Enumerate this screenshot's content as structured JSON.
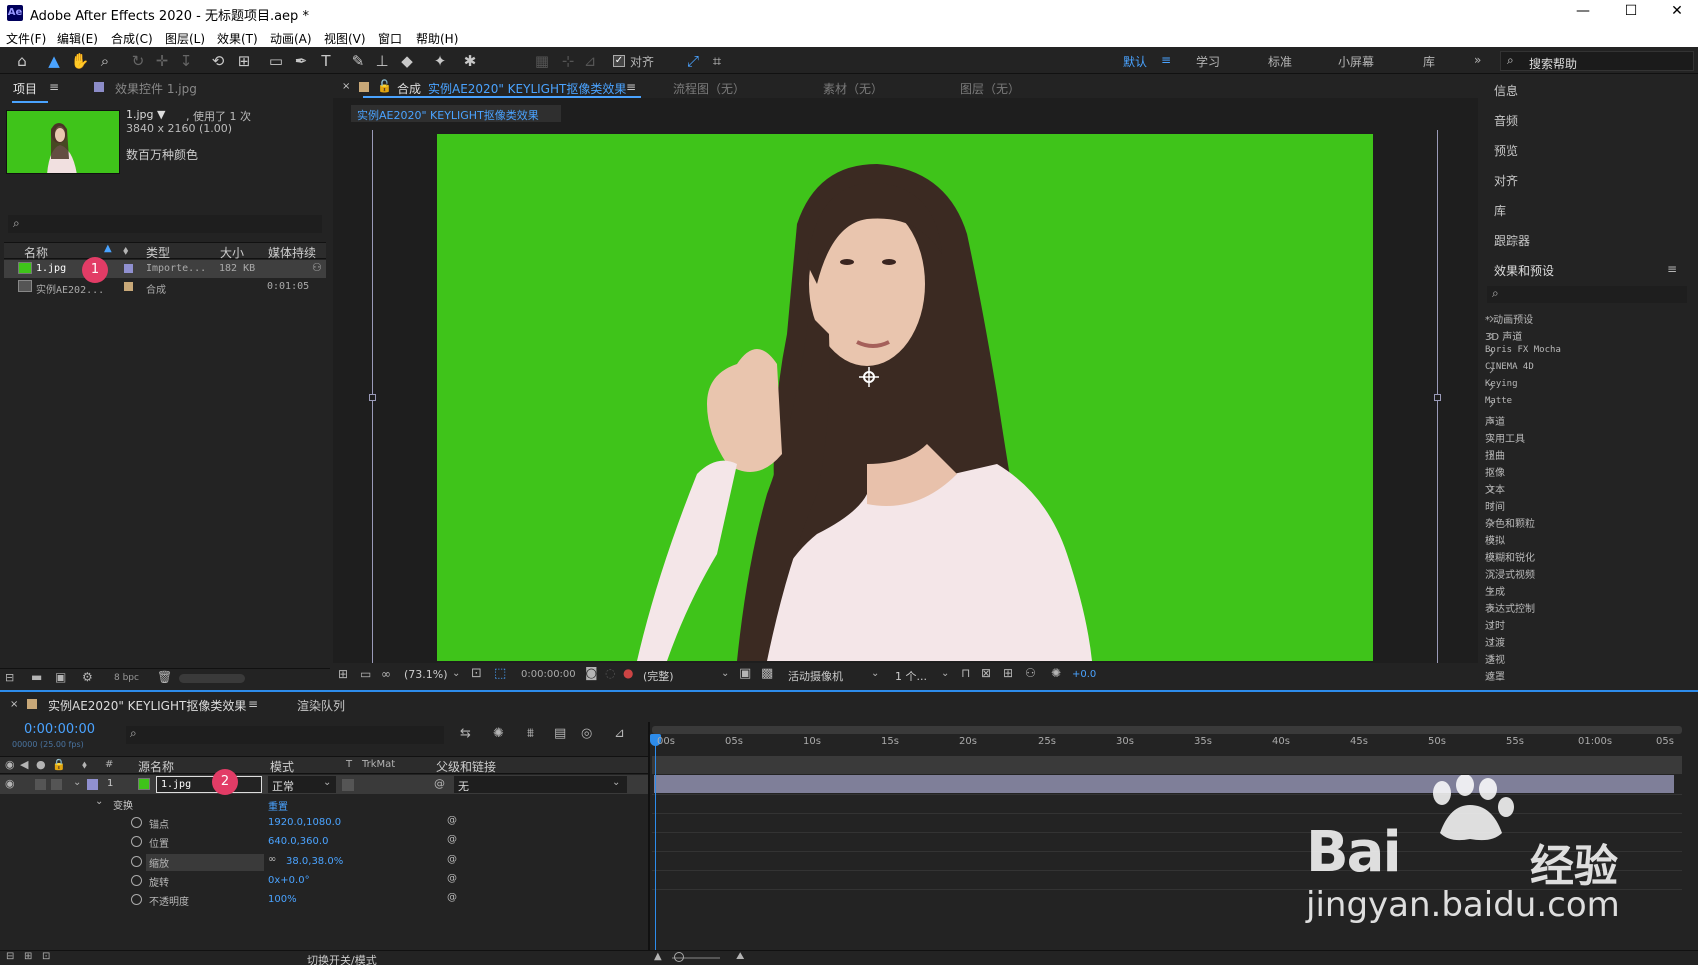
{
  "title_bar": {
    "app_title": "Adobe After Effects 2020 - 无标题项目.aep *",
    "ae_logo": "Ae",
    "minimize": "—",
    "maximize": "☐",
    "close": "✕"
  },
  "menu": [
    "文件(F)",
    "编辑(E)",
    "合成(C)",
    "图层(L)",
    "效果(T)",
    "动画(A)",
    "视图(V)",
    "窗口",
    "帮助(H)"
  ],
  "toolbar": {
    "snap_label": "对齐",
    "workspaces": [
      "默认",
      "学习",
      "标准",
      "小屏幕",
      "库"
    ],
    "search_placeholder": "搜索帮助"
  },
  "project_panel": {
    "tab_project": "项目",
    "tab_effects_controls": "效果控件 1.jpg",
    "selected_name": "1.jpg ▼",
    "used_count": ", 使用了 1 次",
    "dimensions": "3840 x 2160 (1.00)",
    "colors": "数百万种颜色",
    "columns": [
      "名称",
      "类型",
      "大小",
      "媒体持续"
    ],
    "items": [
      {
        "name": "1.jpg",
        "type": "Importe...",
        "size": "182 KB",
        "duration": ""
      },
      {
        "name": "实例AE202...",
        "type": "合成",
        "size": "",
        "duration": "0:01:05"
      }
    ],
    "bpc": "8 bpc"
  },
  "viewer": {
    "tab_prefix": "合成",
    "comp_name": "实例AE2020\" KEYLIGHT抠像类效果",
    "tab_flow": "流程图（无）",
    "tab_footage": "素材（无）",
    "tab_layer": "图层（无）",
    "breadcrumb": "实例AE2020\" KEYLIGHT抠像类效果",
    "zoom": "(73.1%)",
    "timecode": "0:00:00:00",
    "resolution": "(完整)",
    "camera": "活动摄像机",
    "views": "1 个...",
    "exposure": "+0.0"
  },
  "right_panel": {
    "items": [
      "信息",
      "音频",
      "预览",
      "对齐",
      "库",
      "跟踪器"
    ],
    "effects_title": "效果和预设",
    "effects": [
      "* 动画预设",
      "3D 声道",
      "Boris FX Mocha",
      "CINEMA 4D",
      "Keying",
      "Matte",
      "声道",
      "实用工具",
      "扭曲",
      "抠像",
      "文本",
      "时间",
      "杂色和颗粒",
      "模拟",
      "模糊和锐化",
      "沉浸式视频",
      "生成",
      "表达式控制",
      "过时",
      "过渡",
      "透视",
      "遮罩"
    ]
  },
  "timeline": {
    "tab_comp": "实例AE2020\" KEYLIGHT抠像类效果",
    "tab_render": "渲染队列",
    "timecode": "0:00:00:00",
    "frame_info": "00000 (25.00 fps)",
    "columns": {
      "source": "源名称",
      "mode": "模式",
      "t": "T",
      "trkmat": "TrkMat",
      "parent": "父级和链接",
      "num": "#"
    },
    "layer": {
      "index": "1",
      "name": "1.jpg",
      "mode": "正常",
      "parent": "无"
    },
    "transform": "变换",
    "reset": "重置",
    "props": [
      {
        "name": "锚点",
        "value": "1920.0,1080.0"
      },
      {
        "name": "位置",
        "value": "640.0,360.0"
      },
      {
        "name": "缩放",
        "value": "38.0,38.0%"
      },
      {
        "name": "旋转",
        "value": "0x+0.0°"
      },
      {
        "name": "不透明度",
        "value": "100%"
      }
    ],
    "ruler": [
      "00s",
      "05s",
      "10s",
      "15s",
      "20s",
      "25s",
      "30s",
      "35s",
      "40s",
      "45s",
      "50s",
      "55s",
      "01:00s",
      "05s"
    ],
    "bottom_label": "切换开关/模式"
  },
  "annotations": [
    "1",
    "2"
  ],
  "watermark": {
    "logo": "Bai",
    "brand": "经验",
    "url": "jingyan.baidu.com"
  }
}
